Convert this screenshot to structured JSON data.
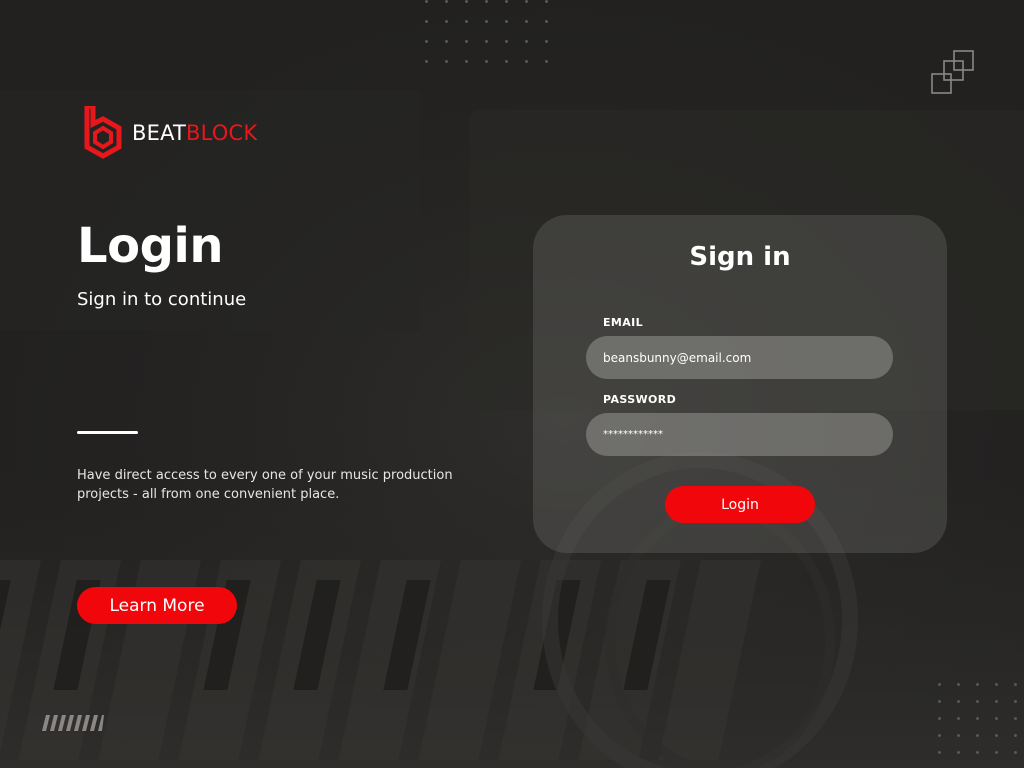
{
  "brand": {
    "name_part1": "BEAT",
    "name_part2": "BLOCK",
    "accent_color": "#f0060b",
    "logo_icon": "hexagon-b-logo-icon"
  },
  "hero": {
    "title": "Login",
    "subtitle": "Sign in to continue",
    "description": "Have direct access to every one of your music production projects - all from one convenient place.",
    "learn_more_label": "Learn More"
  },
  "sign_in": {
    "title": "Sign in",
    "email_label": "EMAIL",
    "email_value": "beansbunny@email.com",
    "password_label": "PASSWORD",
    "password_value": "************",
    "login_label": "Login"
  },
  "decorations": {
    "top_dots": "dot-grid-icon",
    "corner_squares": "stacked-squares-icon",
    "stripes": "slash-stripes-icon",
    "bottom_dots": "dot-grid-icon"
  }
}
